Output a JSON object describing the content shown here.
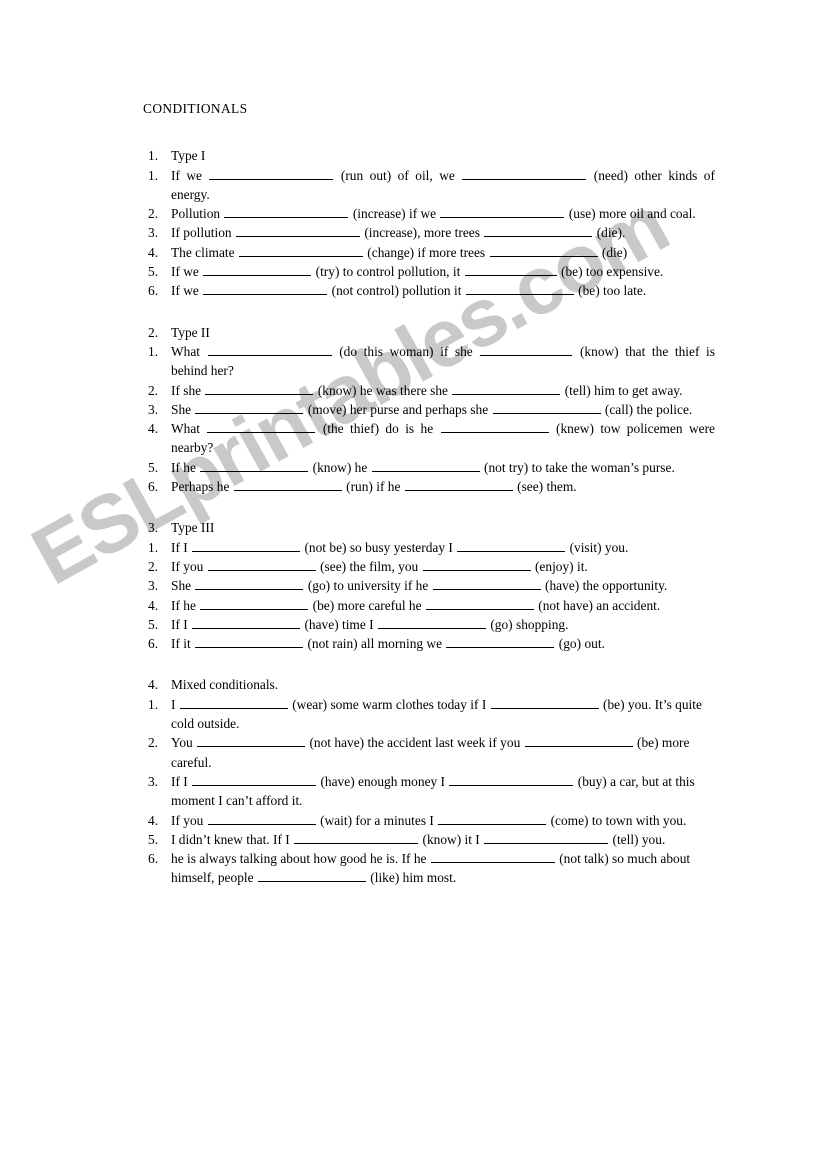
{
  "document": {
    "title": "CONDITIONALS",
    "watermark": "ESLprintables.com",
    "watermark_color": "#c9c9c9"
  },
  "sections": [
    {
      "number": "1.",
      "heading": "Type I",
      "items": [
        {
          "number": "1.",
          "justify": true,
          "parts": [
            "If we",
            "BLANK_XL",
            "(run out) of oil, we",
            "BLANK_XL",
            "(need) other kinds of energy."
          ]
        },
        {
          "number": "2.",
          "justify": true,
          "parts": [
            "Pollution",
            "BLANK_XL",
            "(increase) if we",
            "BLANK_XL",
            "(use) more oil and coal."
          ]
        },
        {
          "number": "3.",
          "justify": false,
          "parts": [
            "If pollution",
            "BLANK_XL",
            "(increase), more trees",
            "BLANK_LG",
            "(die)."
          ]
        },
        {
          "number": "4.",
          "justify": false,
          "parts": [
            "The climate",
            "BLANK_XL",
            "(change) if more trees",
            "BLANK_LG",
            "(die)"
          ]
        },
        {
          "number": "5.",
          "justify": true,
          "parts": [
            "If we",
            "BLANK_LG",
            "(try) to control pollution, it",
            "BLANK_MD",
            "(be) too expensive."
          ]
        },
        {
          "number": "6.",
          "justify": false,
          "parts": [
            "If we",
            "BLANK_XL",
            "(not control) pollution it",
            "BLANK_LG",
            "(be) too late."
          ]
        }
      ]
    },
    {
      "number": "2.",
      "heading": "Type II",
      "items": [
        {
          "number": "1.",
          "justify": true,
          "parts": [
            "What",
            "BLANK_XL",
            "(do this woman) if she",
            "BLANK_MD",
            "(know) that the thief is behind her?"
          ]
        },
        {
          "number": "2.",
          "justify": true,
          "parts": [
            "If she",
            "BLANK_LG",
            "(know) he was there she",
            "BLANK_LG",
            "(tell) him to get away."
          ]
        },
        {
          "number": "3.",
          "justify": true,
          "parts": [
            "She",
            "BLANK_LG",
            "(move) her purse and perhaps she",
            "BLANK_LG",
            "(call) the police."
          ]
        },
        {
          "number": "4.",
          "justify": true,
          "parts": [
            "What",
            "BLANK_LG",
            "(the thief) do is he",
            "BLANK_LG",
            "(knew) tow policemen were nearby?"
          ]
        },
        {
          "number": "5.",
          "justify": true,
          "parts": [
            "If he",
            "BLANK_LG",
            "(know) he",
            "BLANK_LG",
            "(not try) to take the woman’s purse."
          ]
        },
        {
          "number": "6.",
          "justify": false,
          "parts": [
            "Perhaps he",
            "BLANK_LG",
            "(run) if he",
            "BLANK_LG",
            "(see) them."
          ]
        }
      ]
    },
    {
      "number": "3.",
      "heading": "Type III",
      "items": [
        {
          "number": "1.",
          "justify": false,
          "parts": [
            "If I",
            "BLANK_LG",
            "(not be) so busy yesterday I",
            "BLANK_LG",
            "(visit) you."
          ]
        },
        {
          "number": "2.",
          "justify": false,
          "parts": [
            "If you",
            "BLANK_LG",
            "(see) the film, you",
            "BLANK_LG",
            "(enjoy) it."
          ]
        },
        {
          "number": "3.",
          "justify": true,
          "parts": [
            "She",
            "BLANK_LG",
            "(go) to university if he",
            "BLANK_LG",
            "(have) the opportunity."
          ]
        },
        {
          "number": "4.",
          "justify": true,
          "parts": [
            "If he",
            "BLANK_LG",
            "(be) more careful he",
            "BLANK_LG",
            "(not have) an accident."
          ]
        },
        {
          "number": "5.",
          "justify": false,
          "parts": [
            "If I",
            "BLANK_LG",
            "(have) time I",
            "BLANK_LG",
            "(go) shopping."
          ]
        },
        {
          "number": "6.",
          "justify": false,
          "parts": [
            "If it",
            "BLANK_LG",
            "(not rain) all morning we",
            "BLANK_LG",
            "(go) out."
          ]
        }
      ]
    },
    {
      "number": "4.",
      "heading": "Mixed conditionals.",
      "items": [
        {
          "number": "1.",
          "justify": false,
          "parts": [
            "I",
            "BLANK_LG",
            "(wear) some warm clothes today if I",
            "BLANK_LG",
            "(be) you. It’s quite cold outside."
          ]
        },
        {
          "number": "2.",
          "justify": false,
          "parts": [
            "You",
            "BLANK_LG",
            "(not have) the accident last week if you",
            "BLANK_LG",
            "(be) more careful."
          ]
        },
        {
          "number": "3.",
          "justify": false,
          "parts": [
            "If I",
            "BLANK_XL",
            "(have) enough money I",
            "BLANK_XL",
            "(buy) a car, but at this moment I can’t afford it."
          ]
        },
        {
          "number": "4.",
          "justify": true,
          "parts": [
            "If you",
            "BLANK_LG",
            "(wait) for a minutes I",
            "BLANK_LG",
            "(come) to town with you."
          ]
        },
        {
          "number": "5.",
          "justify": true,
          "parts": [
            "I didn’t knew that. If I",
            "BLANK_XL",
            "(know) it I",
            "BLANK_XL",
            "(tell) you."
          ]
        },
        {
          "number": "6.",
          "justify": false,
          "parts": [
            "he is always talking about how good he is. If he",
            "BLANK_XL",
            "(not talk) so much about himself, people",
            "BLANK_LG",
            "(like) him most."
          ]
        }
      ]
    }
  ]
}
